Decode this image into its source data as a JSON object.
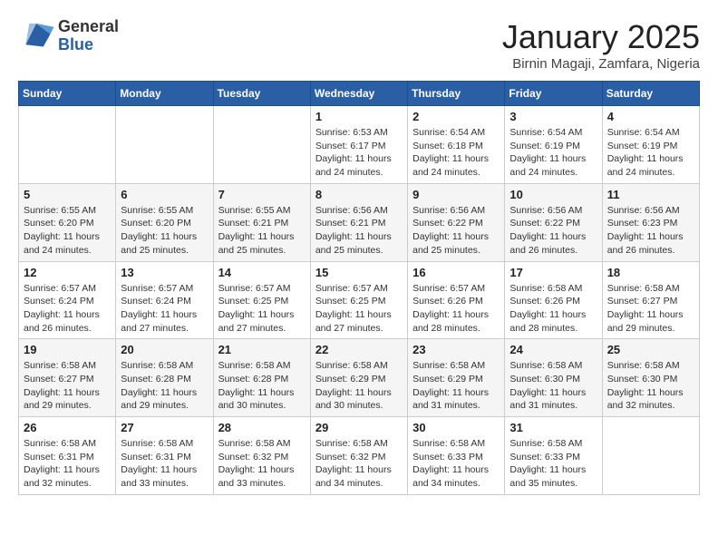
{
  "logo": {
    "general": "General",
    "blue": "Blue"
  },
  "title": "January 2025",
  "location": "Birnin Magaji, Zamfara, Nigeria",
  "weekdays": [
    "Sunday",
    "Monday",
    "Tuesday",
    "Wednesday",
    "Thursday",
    "Friday",
    "Saturday"
  ],
  "weeks": [
    [
      {
        "day": "",
        "info": ""
      },
      {
        "day": "",
        "info": ""
      },
      {
        "day": "",
        "info": ""
      },
      {
        "day": "1",
        "info": "Sunrise: 6:53 AM\nSunset: 6:17 PM\nDaylight: 11 hours and 24 minutes."
      },
      {
        "day": "2",
        "info": "Sunrise: 6:54 AM\nSunset: 6:18 PM\nDaylight: 11 hours and 24 minutes."
      },
      {
        "day": "3",
        "info": "Sunrise: 6:54 AM\nSunset: 6:19 PM\nDaylight: 11 hours and 24 minutes."
      },
      {
        "day": "4",
        "info": "Sunrise: 6:54 AM\nSunset: 6:19 PM\nDaylight: 11 hours and 24 minutes."
      }
    ],
    [
      {
        "day": "5",
        "info": "Sunrise: 6:55 AM\nSunset: 6:20 PM\nDaylight: 11 hours and 24 minutes."
      },
      {
        "day": "6",
        "info": "Sunrise: 6:55 AM\nSunset: 6:20 PM\nDaylight: 11 hours and 25 minutes."
      },
      {
        "day": "7",
        "info": "Sunrise: 6:55 AM\nSunset: 6:21 PM\nDaylight: 11 hours and 25 minutes."
      },
      {
        "day": "8",
        "info": "Sunrise: 6:56 AM\nSunset: 6:21 PM\nDaylight: 11 hours and 25 minutes."
      },
      {
        "day": "9",
        "info": "Sunrise: 6:56 AM\nSunset: 6:22 PM\nDaylight: 11 hours and 25 minutes."
      },
      {
        "day": "10",
        "info": "Sunrise: 6:56 AM\nSunset: 6:22 PM\nDaylight: 11 hours and 26 minutes."
      },
      {
        "day": "11",
        "info": "Sunrise: 6:56 AM\nSunset: 6:23 PM\nDaylight: 11 hours and 26 minutes."
      }
    ],
    [
      {
        "day": "12",
        "info": "Sunrise: 6:57 AM\nSunset: 6:24 PM\nDaylight: 11 hours and 26 minutes."
      },
      {
        "day": "13",
        "info": "Sunrise: 6:57 AM\nSunset: 6:24 PM\nDaylight: 11 hours and 27 minutes."
      },
      {
        "day": "14",
        "info": "Sunrise: 6:57 AM\nSunset: 6:25 PM\nDaylight: 11 hours and 27 minutes."
      },
      {
        "day": "15",
        "info": "Sunrise: 6:57 AM\nSunset: 6:25 PM\nDaylight: 11 hours and 27 minutes."
      },
      {
        "day": "16",
        "info": "Sunrise: 6:57 AM\nSunset: 6:26 PM\nDaylight: 11 hours and 28 minutes."
      },
      {
        "day": "17",
        "info": "Sunrise: 6:58 AM\nSunset: 6:26 PM\nDaylight: 11 hours and 28 minutes."
      },
      {
        "day": "18",
        "info": "Sunrise: 6:58 AM\nSunset: 6:27 PM\nDaylight: 11 hours and 29 minutes."
      }
    ],
    [
      {
        "day": "19",
        "info": "Sunrise: 6:58 AM\nSunset: 6:27 PM\nDaylight: 11 hours and 29 minutes."
      },
      {
        "day": "20",
        "info": "Sunrise: 6:58 AM\nSunset: 6:28 PM\nDaylight: 11 hours and 29 minutes."
      },
      {
        "day": "21",
        "info": "Sunrise: 6:58 AM\nSunset: 6:28 PM\nDaylight: 11 hours and 30 minutes."
      },
      {
        "day": "22",
        "info": "Sunrise: 6:58 AM\nSunset: 6:29 PM\nDaylight: 11 hours and 30 minutes."
      },
      {
        "day": "23",
        "info": "Sunrise: 6:58 AM\nSunset: 6:29 PM\nDaylight: 11 hours and 31 minutes."
      },
      {
        "day": "24",
        "info": "Sunrise: 6:58 AM\nSunset: 6:30 PM\nDaylight: 11 hours and 31 minutes."
      },
      {
        "day": "25",
        "info": "Sunrise: 6:58 AM\nSunset: 6:30 PM\nDaylight: 11 hours and 32 minutes."
      }
    ],
    [
      {
        "day": "26",
        "info": "Sunrise: 6:58 AM\nSunset: 6:31 PM\nDaylight: 11 hours and 32 minutes."
      },
      {
        "day": "27",
        "info": "Sunrise: 6:58 AM\nSunset: 6:31 PM\nDaylight: 11 hours and 33 minutes."
      },
      {
        "day": "28",
        "info": "Sunrise: 6:58 AM\nSunset: 6:32 PM\nDaylight: 11 hours and 33 minutes."
      },
      {
        "day": "29",
        "info": "Sunrise: 6:58 AM\nSunset: 6:32 PM\nDaylight: 11 hours and 34 minutes."
      },
      {
        "day": "30",
        "info": "Sunrise: 6:58 AM\nSunset: 6:33 PM\nDaylight: 11 hours and 34 minutes."
      },
      {
        "day": "31",
        "info": "Sunrise: 6:58 AM\nSunset: 6:33 PM\nDaylight: 11 hours and 35 minutes."
      },
      {
        "day": "",
        "info": ""
      }
    ]
  ]
}
